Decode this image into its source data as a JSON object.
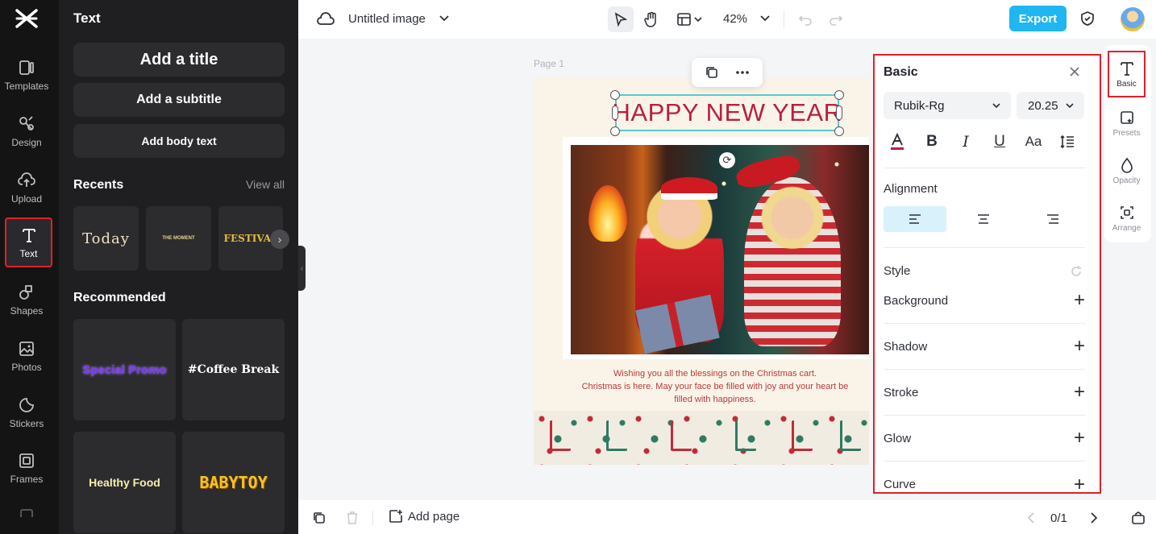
{
  "rail": {
    "items": [
      {
        "label": "Templates",
        "icon": "templates-icon"
      },
      {
        "label": "Design",
        "icon": "design-icon"
      },
      {
        "label": "Upload",
        "icon": "upload-icon"
      },
      {
        "label": "Text",
        "icon": "text-icon"
      },
      {
        "label": "Shapes",
        "icon": "shapes-icon"
      },
      {
        "label": "Photos",
        "icon": "photos-icon"
      },
      {
        "label": "Stickers",
        "icon": "stickers-icon"
      },
      {
        "label": "Frames",
        "icon": "frames-icon"
      }
    ]
  },
  "panel": {
    "title": "Text",
    "add_title": "Add a title",
    "add_subtitle": "Add a subtitle",
    "add_body": "Add body text",
    "recents_label": "Recents",
    "view_all": "View all",
    "recents": [
      "Today",
      "THE MOMENT",
      "FESTIVAL"
    ],
    "recommended_label": "Recommended",
    "recommended": [
      "Special Promo",
      "#Coffee Break",
      "Healthy Food",
      "BABYTOY"
    ]
  },
  "topbar": {
    "doc_title": "Untitled image",
    "zoom": "42%",
    "export": "Export"
  },
  "canvas": {
    "page_label": "Page 1",
    "title_text": "HAPPY NEW YEAR",
    "greeting_line1": "Wishing you all the blessings on the Christmas cart.",
    "greeting_line2": "Christmas is here. May your face be filled with joy and your heart be",
    "greeting_line3": "filled with happiness."
  },
  "props": {
    "title": "Basic",
    "font": "Rubik-Rg",
    "size": "20.25",
    "alignment_label": "Alignment",
    "style_label": "Style",
    "styles": [
      "Background",
      "Shadow",
      "Stroke",
      "Glow",
      "Curve"
    ]
  },
  "strip": {
    "items": [
      "Basic",
      "Presets",
      "Opacity",
      "Arrange"
    ]
  },
  "bottombar": {
    "add_page": "Add page",
    "page_count": "0/1"
  },
  "colors": {
    "accent": "#1fb6f1",
    "highlight_border": "#e0202a",
    "title_red": "#b82040",
    "selection": "#56c8d4"
  }
}
